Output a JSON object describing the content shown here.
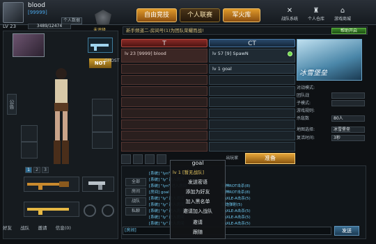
{
  "user": {
    "name": "blood",
    "id_text": "[99999]",
    "level": "LV 23",
    "exp": "3489/12474",
    "personal_data_btn": "个人数据",
    "rank_label": "未评级"
  },
  "main_tabs": [
    {
      "label": "自由竞技",
      "active": true
    },
    {
      "label": "个人联赛",
      "active": false
    },
    {
      "label": "军火库",
      "active": true
    }
  ],
  "right_nav": [
    {
      "label": "战队系统",
      "icon": "team-icon"
    },
    {
      "label": "个人仓库",
      "icon": "warehouse-icon"
    },
    {
      "label": "游戏商城",
      "icon": "shop-icon"
    }
  ],
  "announcement": "新手频道二-房间号(1)为团队荣耀而战!",
  "help_btn": "帮助开启",
  "left_panel": {
    "side_tab": "公告",
    "weapon_tag": "NOT",
    "weapon_tag_sub": "GHOST",
    "pages": [
      "1",
      "2",
      "3"
    ]
  },
  "teams": {
    "t_label": "T",
    "ct_label": "CT",
    "t_slots": [
      {
        "level": "lv 23",
        "id": "[9999]",
        "name": "blood"
      }
    ],
    "ct_slots": [
      {
        "level": "lv 57",
        "id": "[9]",
        "name": "SpawN",
        "ready": true
      },
      {
        "level": "lv 1",
        "id": "",
        "name": "goal",
        "ready": false
      }
    ]
  },
  "map": {
    "name": "冰雪堡垒"
  },
  "settings": [
    {
      "label": "对战模式:",
      "value": ""
    },
    {
      "label": "团队战",
      "value": ""
    },
    {
      "label": "子模式:",
      "value": ""
    },
    {
      "label": "游戏规则:",
      "value": ""
    },
    {
      "label": "杀敌数",
      "value": "80人"
    },
    {
      "label": "地图选择:",
      "value": "冰雪堡垒"
    },
    {
      "label": "复活时间:",
      "value": "3秒"
    }
  ],
  "action_bar": {
    "extra_btn": "出玩家",
    "ready_btn": "准备"
  },
  "chat": {
    "tabs": [
      "全部",
      "房间",
      "战队",
      "私聊"
    ],
    "lines": [
      "[系统] \"lyn\" 进入房间",
      "[系统] \"ly\" 进入房间",
      "[系统] \"lyn\" 进入房间",
      "[房间] goal",
      "[系统] \"ly\" 进入房间",
      "[系统] \"ly\" 进入房间",
      "[系统] \"ly\" 进入房间",
      "[系统] \"ly\" 进入房间",
      "[系统] \"ly\" 进入房间"
    ],
    "right_lines": [
      "霸神ROT击杀(8)",
      "霸神ROT击杀(8)",
      "ngXLE-A击杀(5)",
      "舰炮弹射(5)",
      "ngXLE-A击杀(5)",
      "ngXLE-A击杀(5)",
      "ngXLE-A击杀(5)",
      "NGLE-A击杀(5)"
    ],
    "channel_label": "[房间]",
    "send": "发送"
  },
  "bottom_nav": [
    "好友",
    "战队",
    "邀请",
    "信息(0)"
  ],
  "context_menu": {
    "title": "goal",
    "level": "lv 1",
    "team_status": "[暂无战队]",
    "items": [
      "发送密语",
      "添加为好友",
      "加入黑名单",
      "邀请加入战队",
      "邀请",
      "跟随"
    ]
  }
}
